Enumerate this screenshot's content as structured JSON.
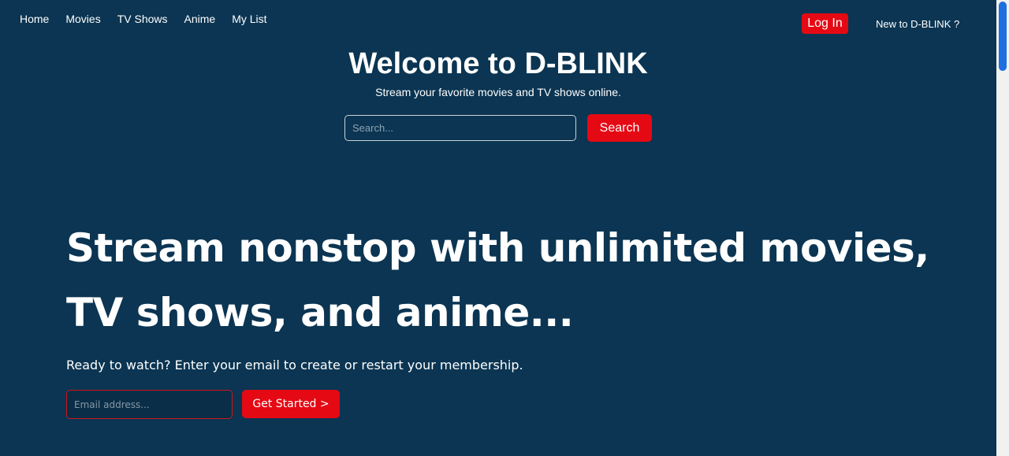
{
  "nav": {
    "items": [
      "Home",
      "Movies",
      "TV Shows",
      "Anime",
      "My List"
    ]
  },
  "auth": {
    "login_label": "Log In",
    "new_label": "New to D-BLINK ?"
  },
  "header": {
    "title": "Welcome to D-BLINK",
    "tagline": "Stream your favorite movies and TV shows online.",
    "search_placeholder": "Search...",
    "search_button": "Search"
  },
  "hero": {
    "title_line1": "Stream nonstop with unlimited movies,",
    "title_line2": "TV shows, and anime...",
    "subtitle": "Ready to watch? Enter your email to create or restart your membership.",
    "email_placeholder": "Email address...",
    "cta_label": "Get Started >"
  },
  "colors": {
    "background": "#0b3552",
    "accent": "#e50914"
  }
}
